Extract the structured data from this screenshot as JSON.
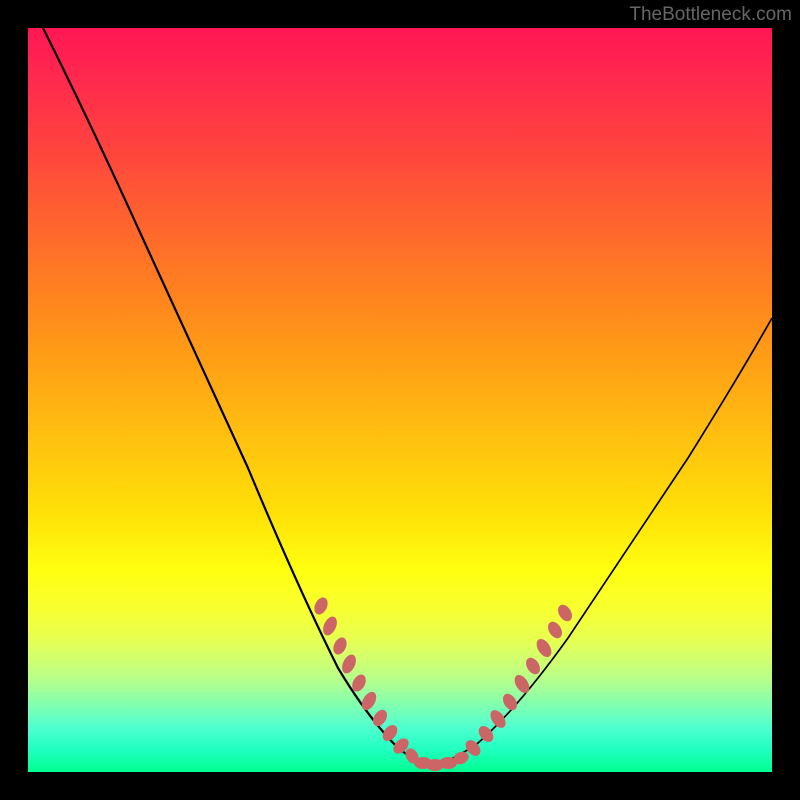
{
  "watermark": "TheBottleneck.com",
  "chart_data": {
    "type": "line",
    "title": "",
    "xlabel": "",
    "ylabel": "",
    "xlim": [
      0,
      100
    ],
    "ylim": [
      0,
      100
    ],
    "main_curve": {
      "name": "bottleneck-curve",
      "description": "V-shaped curve with minimum near x=53",
      "x": [
        2,
        8,
        15,
        22,
        30,
        38,
        44,
        48,
        51,
        53,
        55,
        57,
        60,
        65,
        72,
        80,
        90,
        100
      ],
      "y": [
        100,
        88,
        74,
        60,
        44,
        28,
        16,
        8,
        3,
        1,
        1,
        3,
        8,
        16,
        28,
        40,
        52,
        62
      ]
    },
    "highlight_segments": {
      "name": "dotted-highlights",
      "color": "#d46a6a",
      "left": {
        "x": [
          38,
          40,
          42,
          44,
          46,
          48,
          50,
          52,
          53
        ],
        "y": [
          26,
          22,
          18,
          14,
          10,
          6,
          3,
          1.5,
          1
        ]
      },
      "right": {
        "x": [
          53,
          55,
          57,
          59,
          61,
          63,
          65,
          67
        ],
        "y": [
          1,
          2,
          4,
          7,
          11,
          15,
          19,
          23
        ]
      },
      "bottom": {
        "x": [
          48,
          50,
          52,
          54,
          56,
          58
        ],
        "y": [
          2,
          1.2,
          1,
          1,
          1.5,
          2.5
        ]
      }
    },
    "gradient_colors": {
      "top": "#ff1754",
      "middle": "#ffe008",
      "bottom": "#00ff90"
    }
  }
}
